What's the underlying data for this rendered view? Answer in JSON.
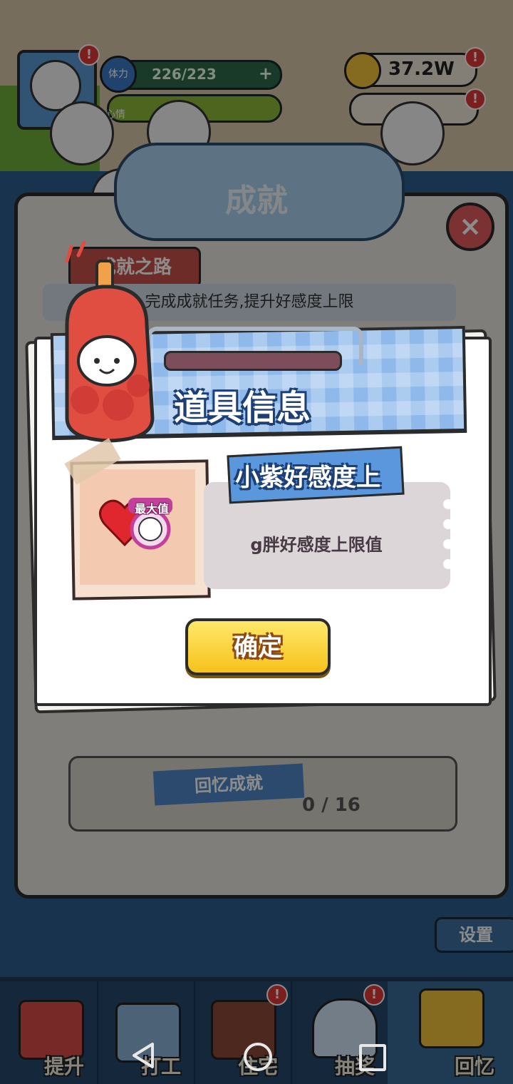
{
  "status": {
    "stamina_label": "体力",
    "stamina_value": "226/223",
    "mood_label": "心情",
    "coins": "37.2W"
  },
  "achievement": {
    "title": "成就",
    "road_label": "成就之路",
    "subtitle": "完成成就任务,提升好感度上限",
    "memory_label": "回忆成就",
    "memory_count": "0 / 16"
  },
  "settings_label": "设置",
  "dialog": {
    "title": "道具信息",
    "item_name": "小紫好感度上",
    "item_badge": "最大值",
    "description": "g胖好感度上限值",
    "confirm_label": "确定"
  },
  "bottom_nav": [
    {
      "label": "提升",
      "icon": "book-icon"
    },
    {
      "label": "打工",
      "icon": "work-icon"
    },
    {
      "label": "住宅",
      "icon": "house-icon"
    },
    {
      "label": "抽奖",
      "icon": "gacha-icon"
    },
    {
      "label": "回忆",
      "icon": "camera-icon"
    }
  ],
  "colors": {
    "accent_blue": "#5b97dc",
    "button_yellow": "#f6c21c",
    "alert_red": "#e03838"
  }
}
